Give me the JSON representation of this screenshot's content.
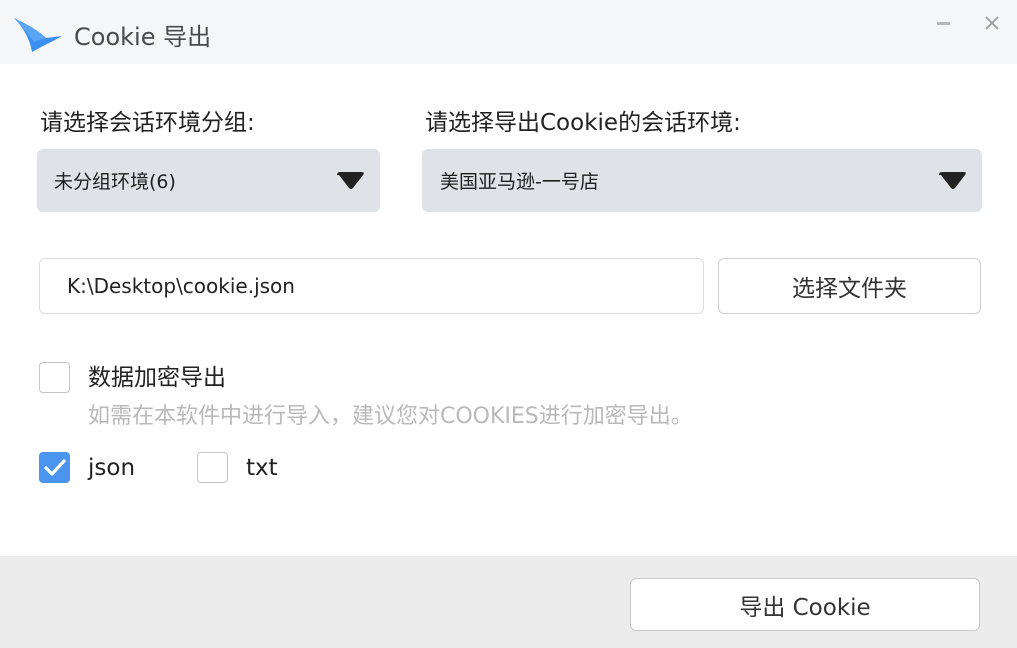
{
  "window": {
    "title": "Cookie 导出"
  },
  "form": {
    "group_label": "请选择会话环境分组:",
    "group_value": "未分组环境(6)",
    "env_label": "请选择导出Cookie的会话环境:",
    "env_value": "美国亚马逊-一号店",
    "path_value": "K:\\Desktop\\cookie.json",
    "folder_button": "选择文件夹",
    "encrypt_label": "数据加密导出",
    "encrypt_checked": false,
    "encrypt_hint": "如需在本软件中进行导入，建议您对COOKIES进行加密导出。",
    "json_label": "json",
    "json_checked": true,
    "txt_label": "txt",
    "txt_checked": false
  },
  "footer": {
    "export_button": "导出 Cookie"
  },
  "colors": {
    "accent": "#4b94ef",
    "logo": "#3b8ff0",
    "dropdown_bg": "#dfe3e8",
    "footer_bg": "#ececec"
  },
  "icons": {
    "logo": "bird-logo-icon",
    "minimize": "minimize-icon",
    "close": "close-icon",
    "dropdown": "caret-down-icon",
    "check": "checkmark-icon"
  }
}
